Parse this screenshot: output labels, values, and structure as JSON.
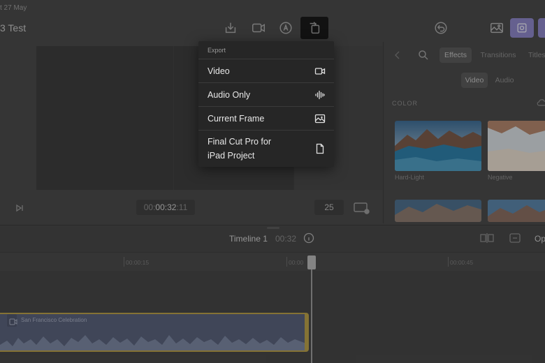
{
  "header": {
    "date": "t 27 May",
    "project_title": "3 Test"
  },
  "transport": {
    "timecode_dim": "00:",
    "timecode_main": "00:32",
    "timecode_frames": ":11",
    "fps": "25"
  },
  "inspector": {
    "tabs": [
      "Effects",
      "Transitions",
      "Titles"
    ],
    "subtabs": [
      "Video",
      "Audio"
    ],
    "section": "COLOR",
    "thumbnails": [
      {
        "label": "Hard-Light"
      },
      {
        "label": "Negative"
      }
    ]
  },
  "timeline": {
    "title": "Timeline 1",
    "duration": "00:32",
    "ruler_labels": [
      "00:00:15",
      "00:00",
      "00:00:45"
    ],
    "right_label": "Op",
    "clip_title": "San Francisco Celebration"
  },
  "export_menu": {
    "header": "Export",
    "items": [
      {
        "label": "Video",
        "icon": "video-camera-icon"
      },
      {
        "label": "Audio Only",
        "icon": "waveform-icon"
      },
      {
        "label": "Current Frame",
        "icon": "photo-icon"
      },
      {
        "label_line1": "Final Cut Pro for",
        "label_line2": "iPad Project",
        "icon": "document-icon"
      }
    ]
  },
  "colors": {
    "accent_purple": "#8c86c6",
    "clip_border": "#b9a04a",
    "menu_bg": "#262626"
  }
}
